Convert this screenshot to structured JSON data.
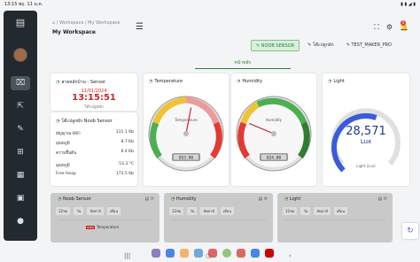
{
  "status": {
    "time": "13:15",
    "date": "พฤ. 11 ม.ค.",
    "icons": "▮ ▮ ◢ ▮"
  },
  "sidebar": {
    "logo_icon": "layout-icon",
    "items": [
      {
        "name": "monitor",
        "icon": "⌧"
      },
      {
        "name": "export",
        "icon": "⇱"
      },
      {
        "name": "tools",
        "icon": "✎"
      },
      {
        "name": "network",
        "icon": "⊞"
      },
      {
        "name": "dashboard",
        "icon": "▦"
      },
      {
        "name": "chip",
        "icon": "▣"
      },
      {
        "name": "user",
        "icon": "●"
      }
    ]
  },
  "header": {
    "crumb_home": "⌂",
    "crumb_1": "Workspace",
    "crumb_sep": "/",
    "crumb_2": "My Workspace",
    "title": "My Workspace",
    "menu": "☰",
    "notif_count": "0"
  },
  "tabs": [
    {
      "label": "✎ NOOB SENSOR",
      "active": true
    },
    {
      "label": "✎ โต๊ะปลูกผัก",
      "active": false
    },
    {
      "label": "✎ TEST_MAKER_PRO",
      "active": false
    }
  ],
  "subtab": "หน้าหลัก",
  "card_time": {
    "title": "สายหลักบ้าน - Sensor",
    "date": "11/01/2024",
    "time": "13:15:51",
    "sub": "โต๊ะปลูกผัก"
  },
  "card_info": {
    "title": "โต๊ะปลูกผัก Noob Sensor",
    "rows": [
      {
        "label": "สัญญาณ WiFi",
        "value": "131.1 Kb"
      },
      {
        "label": "อุณหภูมิ",
        "value": "8.7 Kb"
      },
      {
        "label": "ความชื้นดิน",
        "value": "6.4 Kb"
      },
      {
        "label": "อุณหภูมิ",
        "value": "53.3 °C"
      },
      {
        "label": "Free Heap",
        "value": "173.5 Kb"
      }
    ]
  },
  "gauge_temp": {
    "title": "Temperature",
    "label": "Temperature",
    "value": "053.80",
    "level": 0.54
  },
  "gauge_hum": {
    "title": "Humidity",
    "label": "Humidity",
    "value": "024.80",
    "level": 0.25
  },
  "light": {
    "title": "Light",
    "value": "28,571",
    "unit": "Lux",
    "label": "Light (Lux)",
    "level": 0.57
  },
  "bottom": [
    {
      "title": "Noob Sensor",
      "btn1": "12ชม",
      "btn2": "วัน",
      "btn3": "สัปดาห์",
      "btn4": "เดือน",
      "legend": "Temperature"
    },
    {
      "title": "Humidity",
      "btn1": "12ชม",
      "btn2": "วัน",
      "btn3": "สัปดาห์",
      "btn4": "เดือน"
    },
    {
      "title": "Light",
      "btn1": "12ชม",
      "btn2": "วัน",
      "btn3": "สัปดาห์",
      "btn4": "เดือน"
    }
  ],
  "colors": {
    "accent": "#2e7d32",
    "sidebar": "#222a30",
    "gauge_green": "#4caf50",
    "gauge_yellow": "#f1c232",
    "gauge_red": "#e53935",
    "light_arc": "#3b5bdb"
  }
}
